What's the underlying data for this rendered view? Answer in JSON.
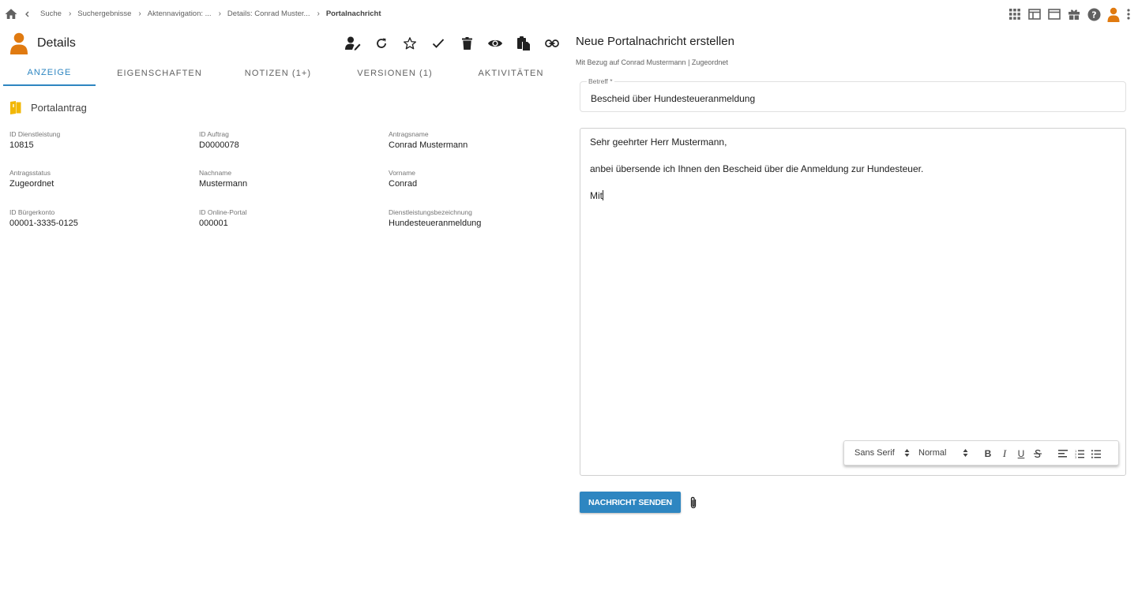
{
  "breadcrumb": {
    "items": [
      "Suche",
      "Suchergebnisse",
      "Aktennavigation: ...",
      "Details: Conrad Muster..."
    ],
    "current": "Portalnachricht"
  },
  "details": {
    "title": "Details",
    "tabs": [
      {
        "label": "Anzeige",
        "active": true
      },
      {
        "label": "Eigenschaften",
        "active": false
      },
      {
        "label": "Notizen (1+)",
        "active": false
      },
      {
        "label": "Versionen (1)",
        "active": false
      },
      {
        "label": "Aktivitäten",
        "active": false
      }
    ],
    "section_title": "Portalantrag",
    "fields": [
      {
        "label": "ID Dienstleistung",
        "value": "10815"
      },
      {
        "label": "ID Auftrag",
        "value": "D0000078"
      },
      {
        "label": "Antragsname",
        "value": "Conrad Mustermann"
      },
      {
        "label": "Antragsstatus",
        "value": "Zugeordnet"
      },
      {
        "label": "Nachname",
        "value": "Mustermann"
      },
      {
        "label": "Vorname",
        "value": "Conrad"
      },
      {
        "label": "ID Bürgerkonto",
        "value": "00001-3335-0125"
      },
      {
        "label": "ID Online-Portal",
        "value": "000001"
      },
      {
        "label": "Dienstleistungsbezeichnung",
        "value": "Hundesteueranmeldung"
      }
    ]
  },
  "message": {
    "title": "Neue Portalnachricht erstellen",
    "subtitle": "Mit Bezug auf Conrad Mustermann | Zugeordnet",
    "subject_label": "Betreff *",
    "subject_value": "Bescheid über Hundesteueranmeldung",
    "body_lines": [
      "Sehr geehrter Herr Mustermann,",
      "anbei übersende ich Ihnen den Bescheid über die Anmeldung zur Hundesteuer.",
      "Mit"
    ],
    "toolbar": {
      "font": "Sans Serif",
      "size": "Normal",
      "bold": "B",
      "italic": "I",
      "underline": "U"
    },
    "send_label": "NACHRICHT SENDEN"
  },
  "colors": {
    "accent": "#2e86c1",
    "avatar": "#e07a10",
    "folder": "#f2b705"
  }
}
